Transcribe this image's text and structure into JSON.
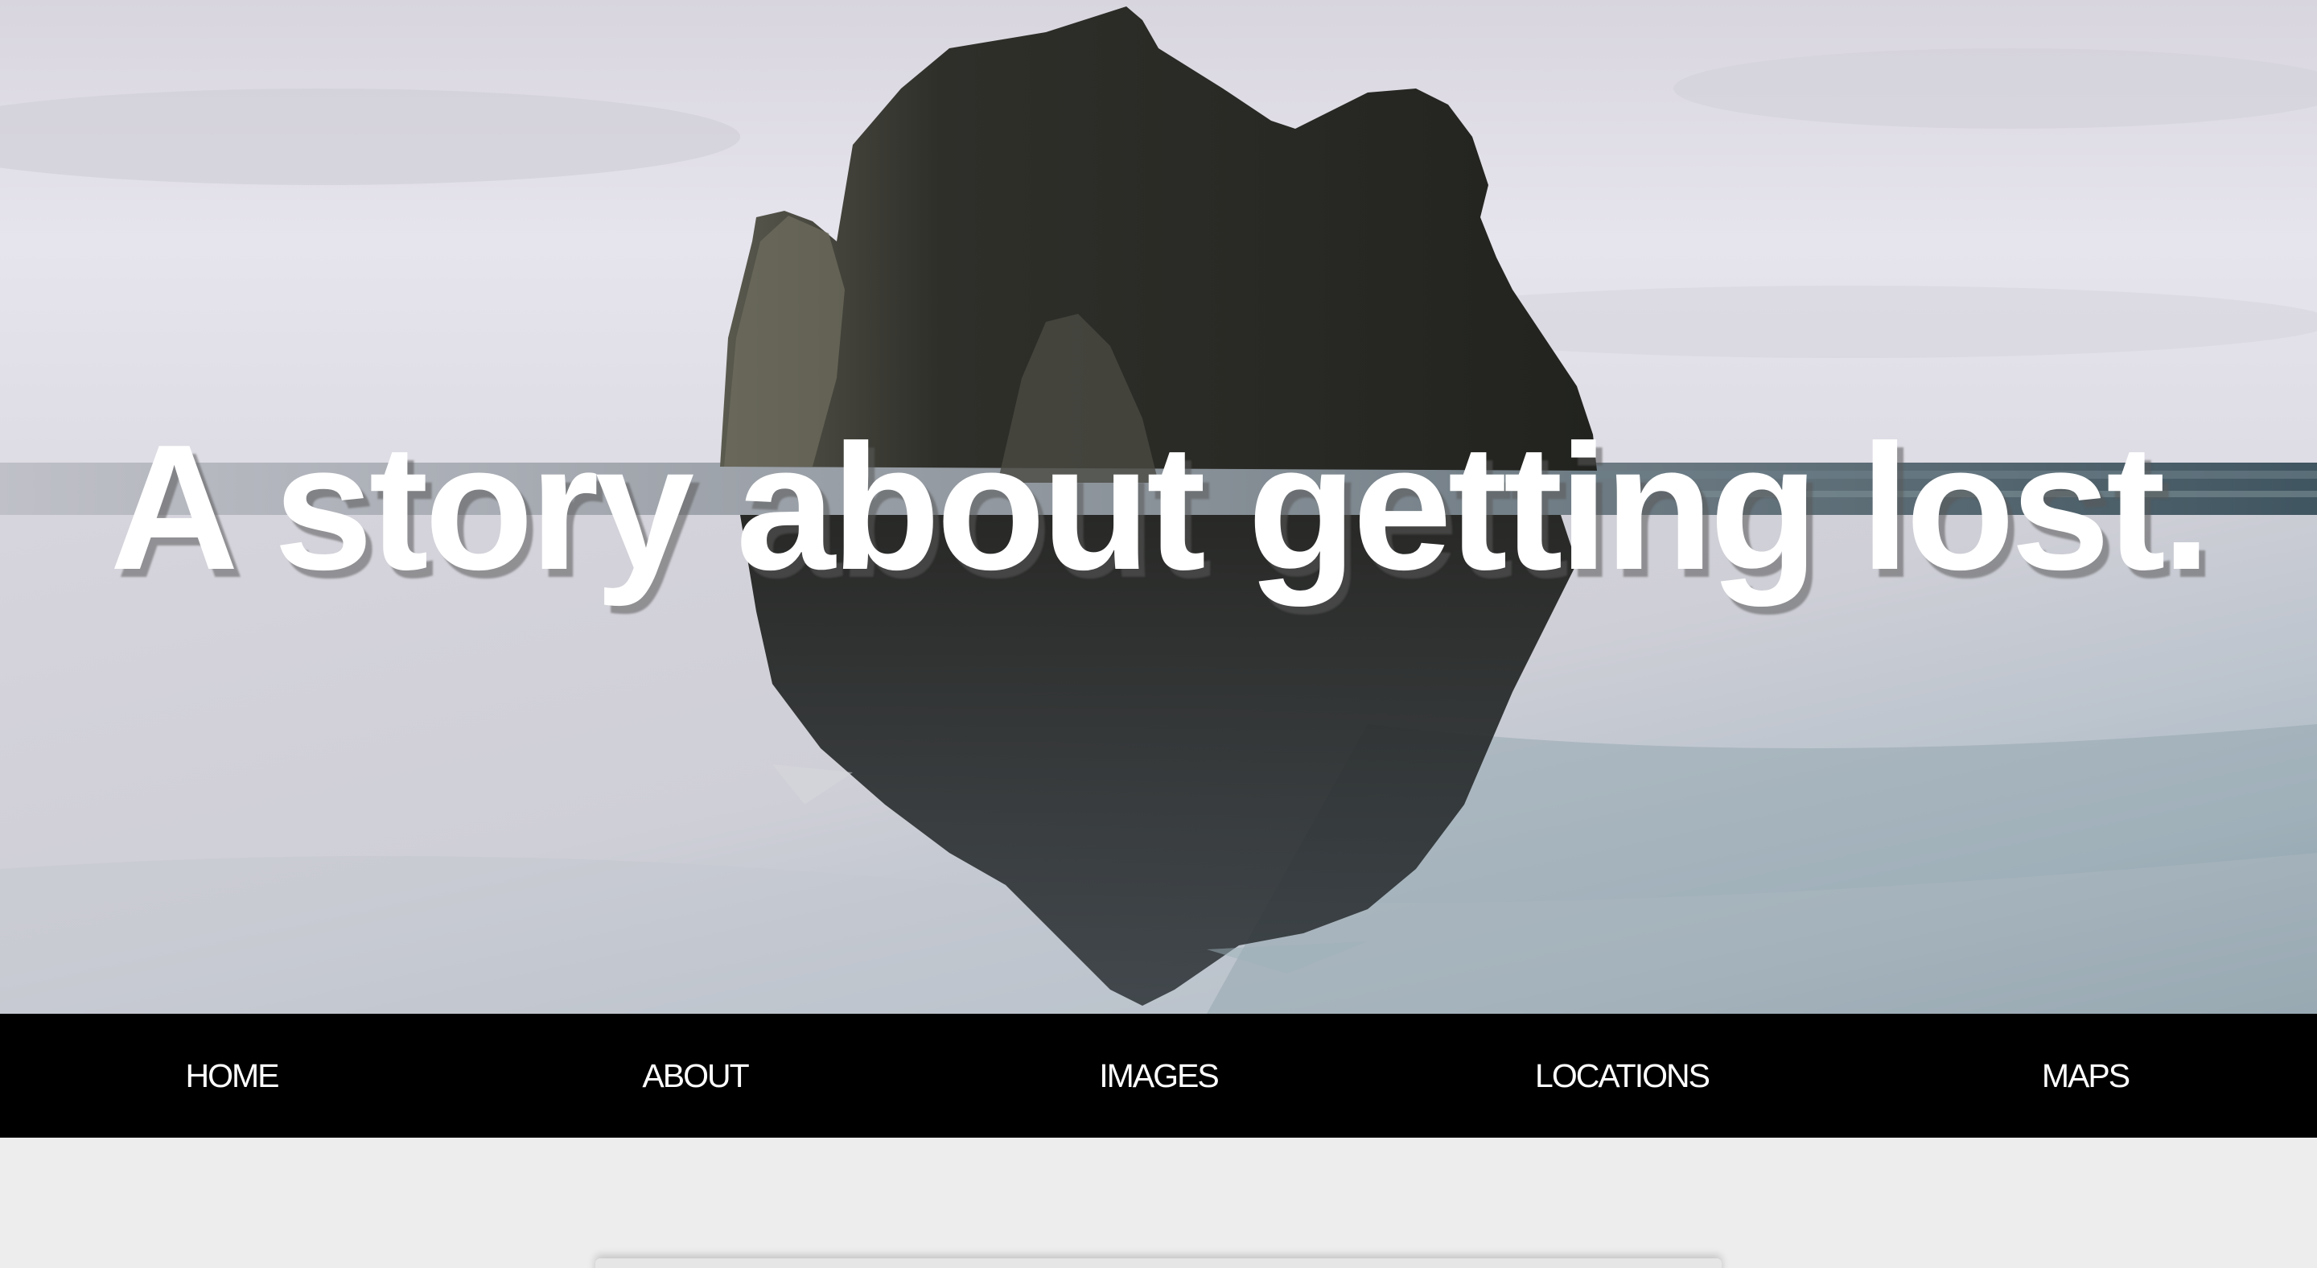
{
  "hero": {
    "title": "A story about getting lost.",
    "image": "sea-stack-beach-reflection-photo"
  },
  "nav": {
    "items": [
      {
        "label": "HOME"
      },
      {
        "label": "ABOUT"
      },
      {
        "label": "IMAGES"
      },
      {
        "label": "LOCATIONS"
      },
      {
        "label": "MAPS"
      }
    ]
  },
  "colors": {
    "nav_background": "#000000",
    "nav_text": "#ffffff",
    "page_background": "#ededed",
    "title_text": "#ffffff"
  }
}
